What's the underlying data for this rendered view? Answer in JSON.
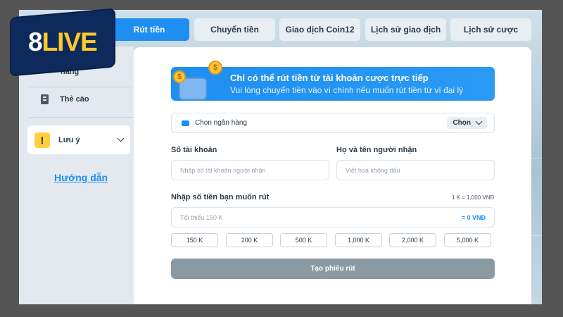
{
  "logo": {
    "brand_part": "8",
    "brand_accent": "LIVE"
  },
  "tabs": [
    {
      "label": "Rút tiền",
      "active": true
    },
    {
      "label": "Chuyển tiền"
    },
    {
      "label": "Giao dịch Coin12"
    },
    {
      "label": "Lịch sử giao dịch"
    },
    {
      "label": "Lịch sử cược"
    }
  ],
  "sidebar": {
    "partial_item_label": "hàng",
    "card_item_label": "Thẻ cào",
    "note_label": "Lưu ý",
    "guide_link": "Hướng dẫn"
  },
  "banner": {
    "title": "Chỉ có thể rút tiền từ tài khoản cược trực tiếp",
    "subtitle": "Vui lòng chuyển tiền vào ví chính nếu muốn rút tiền từ ví đại lý",
    "coin_symbol": "$"
  },
  "bank": {
    "label": "Chọn ngân hàng",
    "button": "Chọn"
  },
  "account": {
    "label": "Số tài khoản",
    "placeholder": "Nhập số tài khoản người nhận"
  },
  "recipient": {
    "label": "Họ và tên người nhận",
    "placeholder": "Viết hoa không dấu"
  },
  "amount": {
    "label": "Nhập số tiền bạn muốn rút",
    "rate": "1 K = 1,000 VNĐ",
    "placeholder": "Tối thiểu 150 K",
    "converted": "= 0 VNĐ"
  },
  "quick_amounts": [
    "150 K",
    "200 K",
    "500 K",
    "1,000 K",
    "2,000 K",
    "5,000 K"
  ],
  "submit_label": "Tạo phiếu rút",
  "colors": {
    "accent": "#1e8ff0",
    "logo_bg": "#0e2a5c",
    "logo_accent": "#ffc928",
    "warning": "#ffcf3f",
    "submit_disabled": "#8a9aa3"
  }
}
